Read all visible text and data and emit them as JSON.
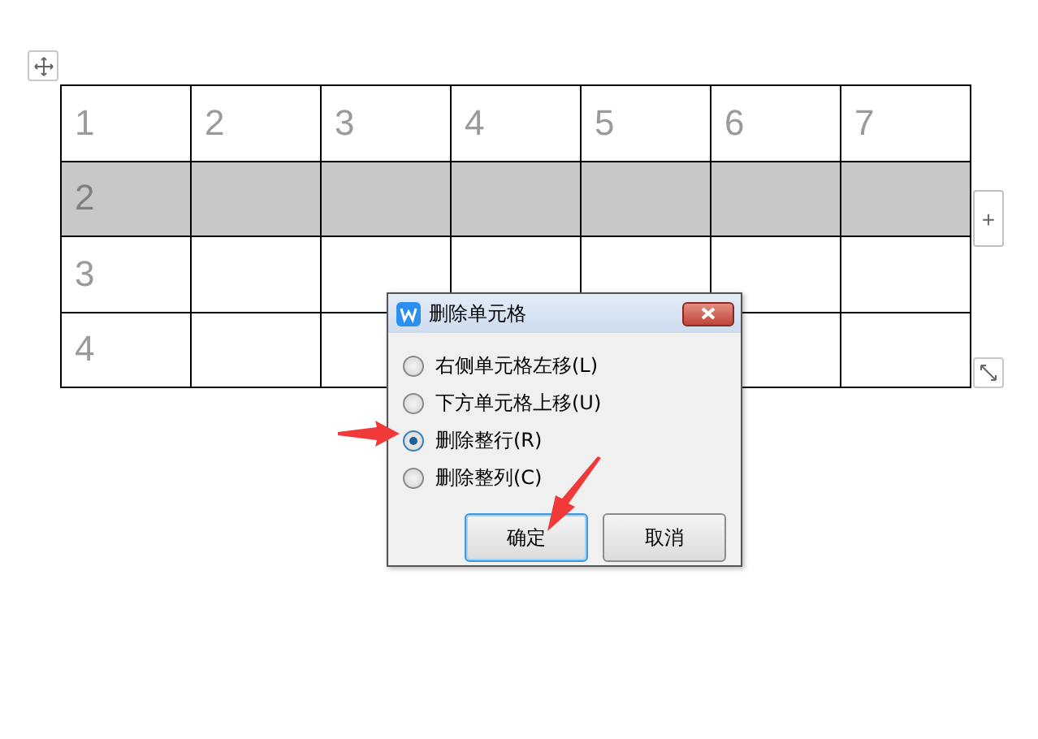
{
  "table": {
    "rows": [
      {
        "selected": false,
        "cells": [
          "1",
          "2",
          "3",
          "4",
          "5",
          "6",
          "7"
        ]
      },
      {
        "selected": true,
        "cells": [
          "2"
        ]
      },
      {
        "selected": false,
        "cells": [
          "3"
        ]
      },
      {
        "selected": false,
        "cells": [
          "4"
        ]
      }
    ],
    "add_row_button": "+"
  },
  "dialog": {
    "title": "删除单元格",
    "options": [
      {
        "label": "右侧单元格左移(L)",
        "selected": false
      },
      {
        "label": "下方单元格上移(U)",
        "selected": false
      },
      {
        "label": "删除整行(R)",
        "selected": true
      },
      {
        "label": "删除整列(C)",
        "selected": false
      }
    ],
    "buttons": [
      {
        "label": "确定",
        "focused": true
      },
      {
        "label": "取消",
        "focused": false
      }
    ]
  }
}
